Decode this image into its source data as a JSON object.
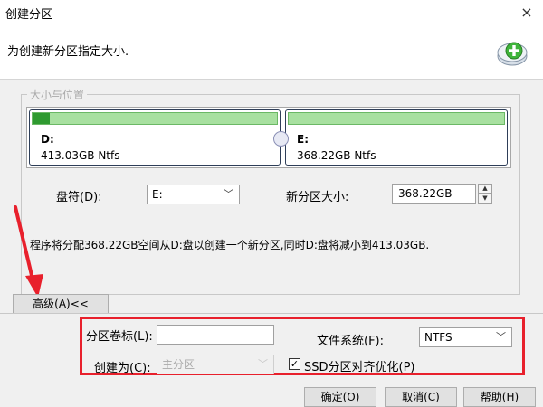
{
  "window": {
    "title": "创建分区",
    "close_glyph": "×"
  },
  "header": {
    "text": "为创建新分区指定大小.",
    "icon": "add-partition-icon"
  },
  "group": {
    "legend": "大小与位置"
  },
  "partitions": [
    {
      "name": "D:",
      "info": "413.03GB Ntfs",
      "used_fraction": 0.07
    },
    {
      "name": "E:",
      "info": "368.22GB Ntfs",
      "used_fraction": 0.0
    }
  ],
  "drive_letter": {
    "label": "盘符(D):",
    "value": "E:"
  },
  "new_size": {
    "label": "新分区大小:",
    "value": "368.22GB"
  },
  "info_text": "程序将分配368.22GB空间从D:盘以创建一个新分区,同时D:盘将减小到413.03GB.",
  "advanced_button": "高级(A)<<",
  "volume_label": {
    "label": "分区卷标(L):",
    "value": ""
  },
  "filesystem": {
    "label": "文件系统(F):",
    "value": "NTFS"
  },
  "create_as": {
    "label": "创建为(C):",
    "value": "主分区"
  },
  "ssd_align": {
    "label": "SSD分区对齐优化(P)",
    "checked": true,
    "check_glyph": "✓"
  },
  "buttons": {
    "ok": "确定(O)",
    "cancel": "取消(C)",
    "help": "帮助(H)"
  },
  "colors": {
    "highlight": "#e8202c",
    "partition_free": "#a8e0a0",
    "partition_used": "#2f9a30"
  }
}
